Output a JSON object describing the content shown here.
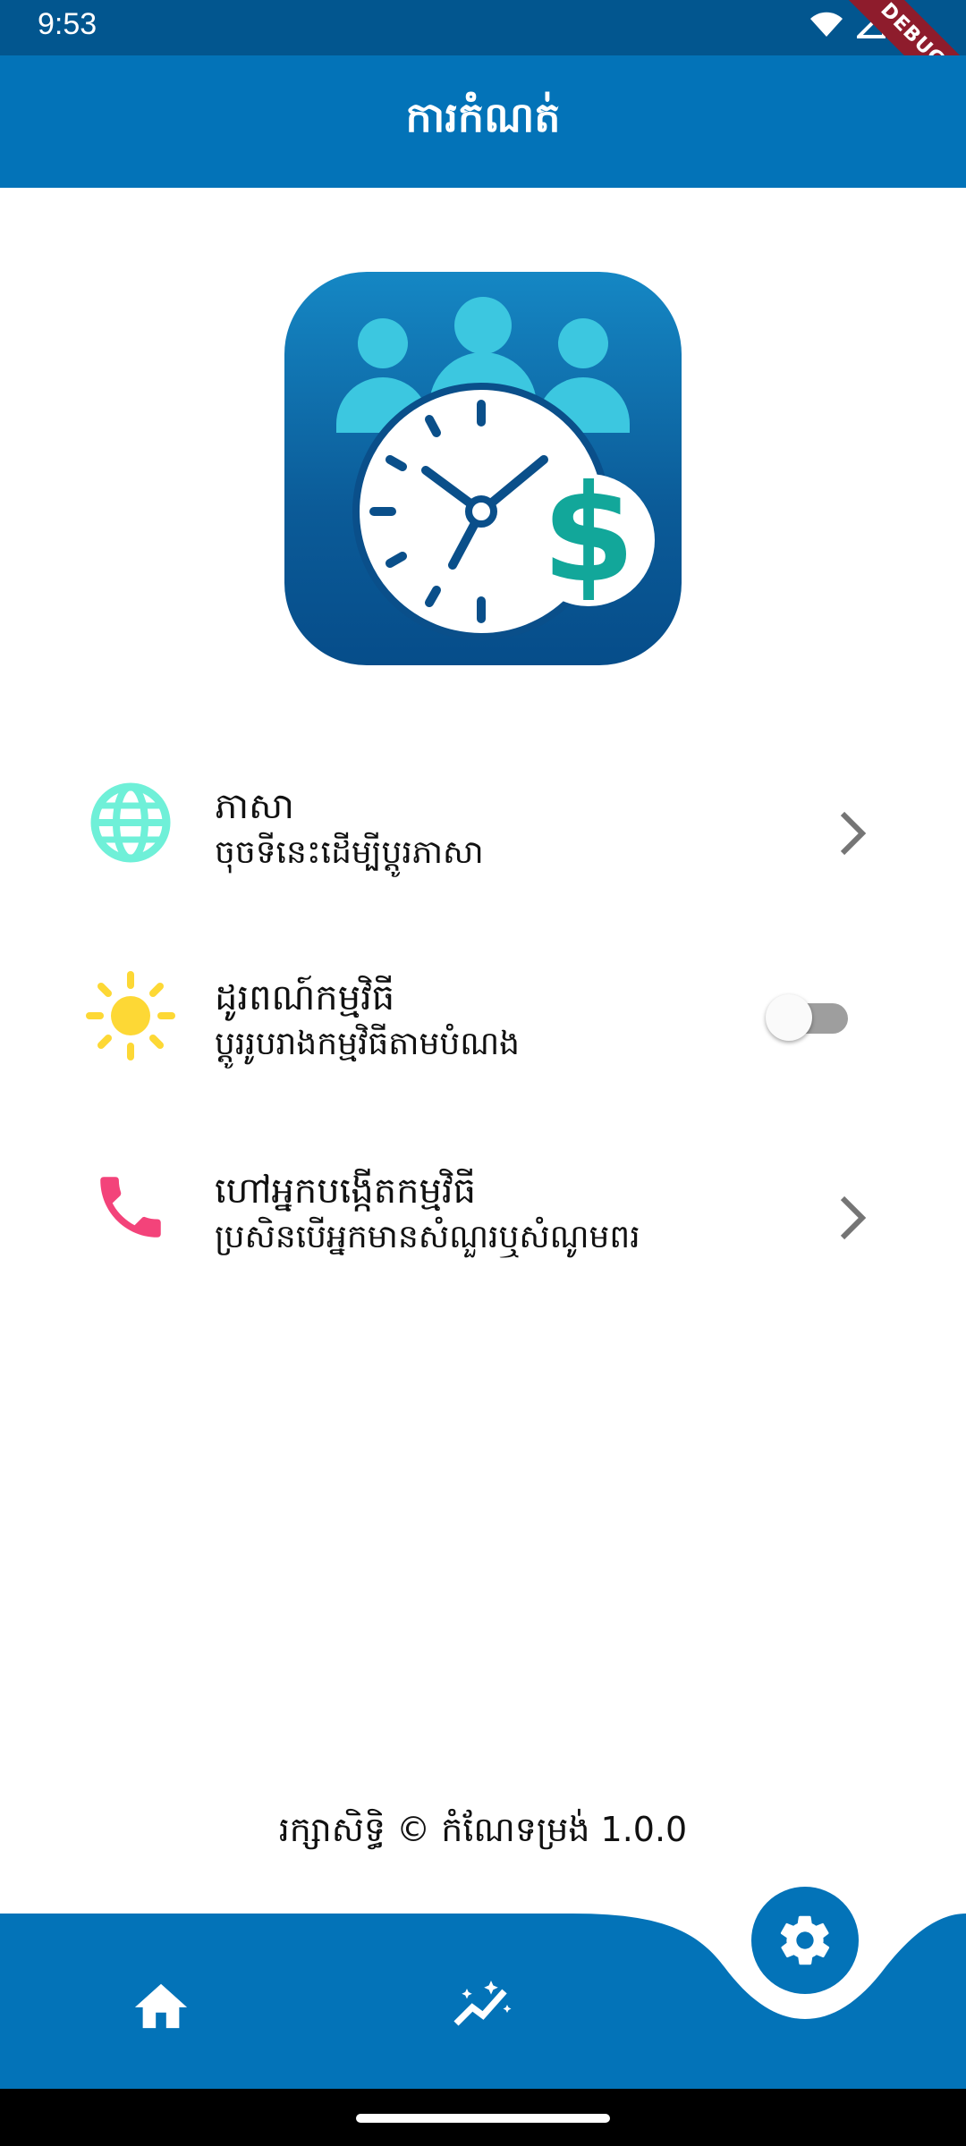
{
  "status_bar": {
    "time": "9:53",
    "icons": [
      "wifi-icon",
      "cellular-signal-icon",
      "battery-icon"
    ],
    "debug_label": "DEBUG"
  },
  "app_bar": {
    "title": "ការកំណត់"
  },
  "logo": {
    "name": "app-logo",
    "icon": "clock-people-dollar-icon"
  },
  "settings": [
    {
      "id": "language",
      "icon": "globe-icon",
      "icon_color": "#6ff0d8",
      "title": "ភាសា",
      "subtitle": "ចុចទីនេះដើម្បីប្ដូរភាសា",
      "action": "chevron"
    },
    {
      "id": "theme",
      "icon": "sun-icon",
      "icon_color": "#fdd835",
      "title": "ដូរពណ៍កម្មវិធី",
      "subtitle": "ប្ដូររូបរាងកម្មវិធីតាមបំណង",
      "action": "toggle",
      "toggle_on": false
    },
    {
      "id": "contact",
      "icon": "phone-icon",
      "icon_color": "#f3437a",
      "title": "ហៅអ្នកបង្កើតកម្មវិធី",
      "subtitle": "ប្រសិនបើអ្នកមានសំណួរឬសំណូមពរ",
      "action": "chevron"
    }
  ],
  "footer": {
    "copyright": "រក្សាសិទ្ធិ © កំណែទម្រង់ 1.0.0"
  },
  "bottom_nav": {
    "items": [
      {
        "id": "home",
        "icon": "home-icon"
      },
      {
        "id": "insights",
        "icon": "insights-icon"
      },
      {
        "id": "settings",
        "icon": "gear-icon",
        "active": true
      }
    ]
  },
  "colors": {
    "primary": "#0373b8",
    "status_bar": "#02568f"
  }
}
